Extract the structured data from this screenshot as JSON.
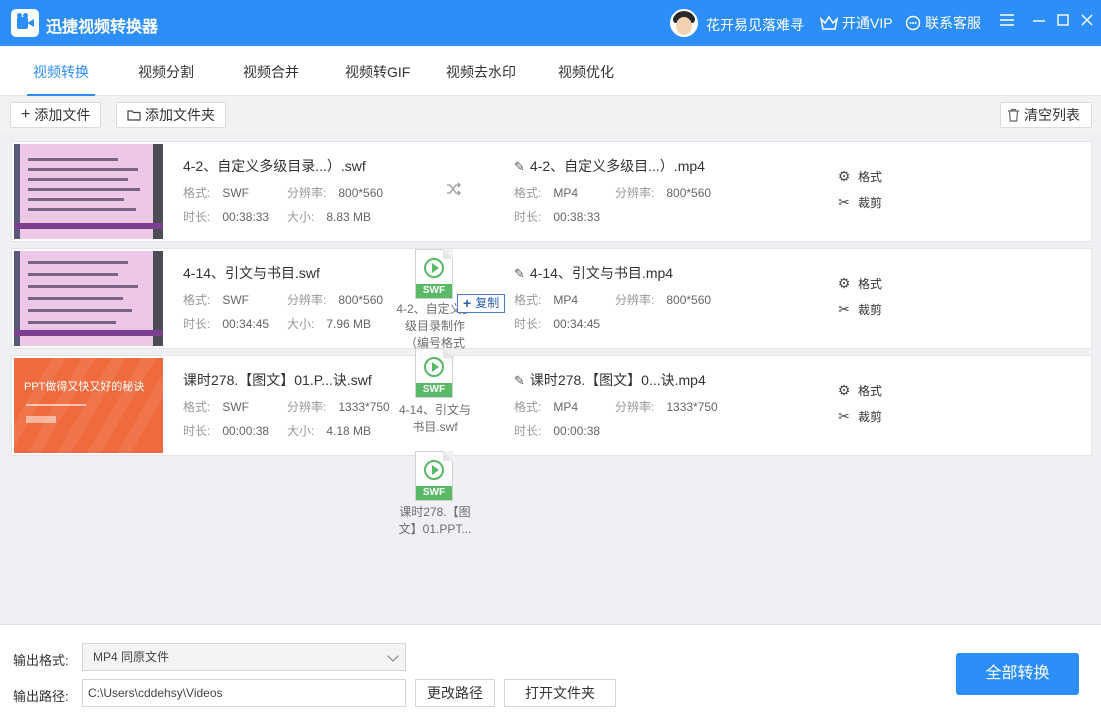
{
  "app": {
    "title": "迅捷视频转换器",
    "user_name": "花开易见落难寻",
    "vip_label": "开通VIP",
    "service_label": "联系客服"
  },
  "tabs": [
    {
      "label": "视频转换",
      "active": true
    },
    {
      "label": "视频分割"
    },
    {
      "label": "视频合并"
    },
    {
      "label": "视频转GIF"
    },
    {
      "label": "视频去水印"
    },
    {
      "label": "视频优化"
    }
  ],
  "toolbar": {
    "add_file": "添加文件",
    "add_folder": "添加文件夹",
    "clear_list": "清空列表"
  },
  "labels": {
    "format": "格式:",
    "resolution": "分辨率:",
    "duration": "时长:",
    "size": "大小:",
    "format_action": "格式",
    "cut_action": "裁剪"
  },
  "files": [
    {
      "name": "4-2、自定义多级目录...）.swf",
      "format": "SWF",
      "resolution": "800*560",
      "duration": "00:38:33",
      "size": "8.83 MB",
      "out_name": "4-2、自定义多级目...）.mp4",
      "out_format": "MP4",
      "out_resolution": "800*560",
      "out_duration": "00:38:33"
    },
    {
      "name": "4-14、引文与书目.swf",
      "format": "SWF",
      "resolution": "800*560",
      "duration": "00:34:45",
      "size": "7.96 MB",
      "out_name": "4-14、引文与书目.mp4",
      "out_format": "MP4",
      "out_resolution": "800*560",
      "out_duration": "00:34:45"
    },
    {
      "name": "课时278.【图文】01.P...诀.swf",
      "format": "SWF",
      "resolution": "1333*750",
      "duration": "00:00:38",
      "size": "4.18 MB",
      "out_name": "课时278.【图文】0...诀.mp4",
      "out_format": "MP4",
      "out_resolution": "1333*750",
      "out_duration": "00:00:38"
    }
  ],
  "thumb_ppt": {
    "title": "PPT做得又快又好的秘诀"
  },
  "drag": {
    "badge": "SWF",
    "copy_label": "复制",
    "items": [
      "4-2、自定义多级目录制作（编号格式与..swf",
      "4-14、引文与书目.swf",
      "课时278.【图文】01.PPT..."
    ]
  },
  "bottom": {
    "output_format_label": "输出格式:",
    "output_format_value": "MP4   同原文件",
    "output_path_label": "输出路径:",
    "output_path_value": "C:\\Users\\cddehsy\\Videos",
    "change_path": "更改路径",
    "open_folder": "打开文件夹",
    "convert_all": "全部转换"
  },
  "colors": {
    "accent": "#2c8ef8",
    "swf_badge": "#4cb45a"
  }
}
